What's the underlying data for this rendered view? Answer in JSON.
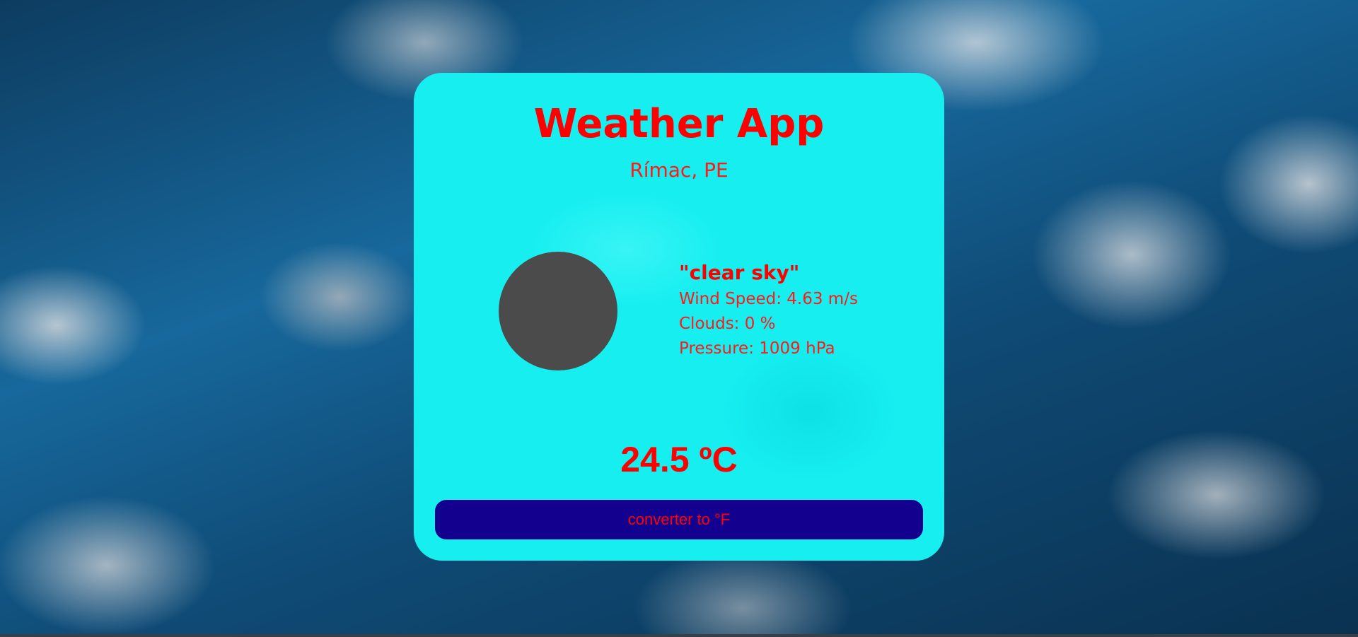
{
  "app": {
    "title": "Weather App",
    "location": "Rímac, PE"
  },
  "weather": {
    "icon": "weather-icon-placeholder",
    "description": "\"clear sky\"",
    "wind_speed": "Wind Speed: 4.63 m/s",
    "clouds": "Clouds: 0 %",
    "pressure": "Pressure: 1009 hPa",
    "temperature": "24.5 ºC"
  },
  "actions": {
    "convert_label": "converter to °F"
  },
  "colors": {
    "card_background": "#16eef0",
    "text_accent": "#ff0000",
    "button_background": "#14008f",
    "icon_placeholder": "#4b4b4b"
  }
}
